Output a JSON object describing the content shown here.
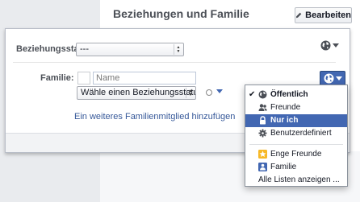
{
  "header": {
    "title": "Beziehungen und Familie",
    "edit_label": "Bearbeiten"
  },
  "relationship": {
    "label": "Beziehungsstatus:",
    "selected": "---"
  },
  "family": {
    "label": "Familie:",
    "name_placeholder": "Name",
    "relation_selected": "Wähle einen Beziehungsstatus:",
    "add_link": "Ein weiteres Familienmitglied hinzufügen"
  },
  "privacy_menu": {
    "items": [
      {
        "label": "Öffentlich",
        "icon": "globe-icon",
        "checked": true
      },
      {
        "label": "Freunde",
        "icon": "friends-icon"
      },
      {
        "label": "Nur ich",
        "icon": "lock-icon",
        "highlighted": true
      },
      {
        "label": "Benutzerdefiniert",
        "icon": "gear-icon"
      },
      {
        "label": "Enge Freunde",
        "icon": "star-icon"
      },
      {
        "label": "Familie",
        "icon": "family-icon"
      },
      {
        "label": "Alle Listen anzeigen ..."
      }
    ]
  },
  "colors": {
    "accent": "#4267b2",
    "link": "#365899",
    "background": "#e9ebee"
  }
}
